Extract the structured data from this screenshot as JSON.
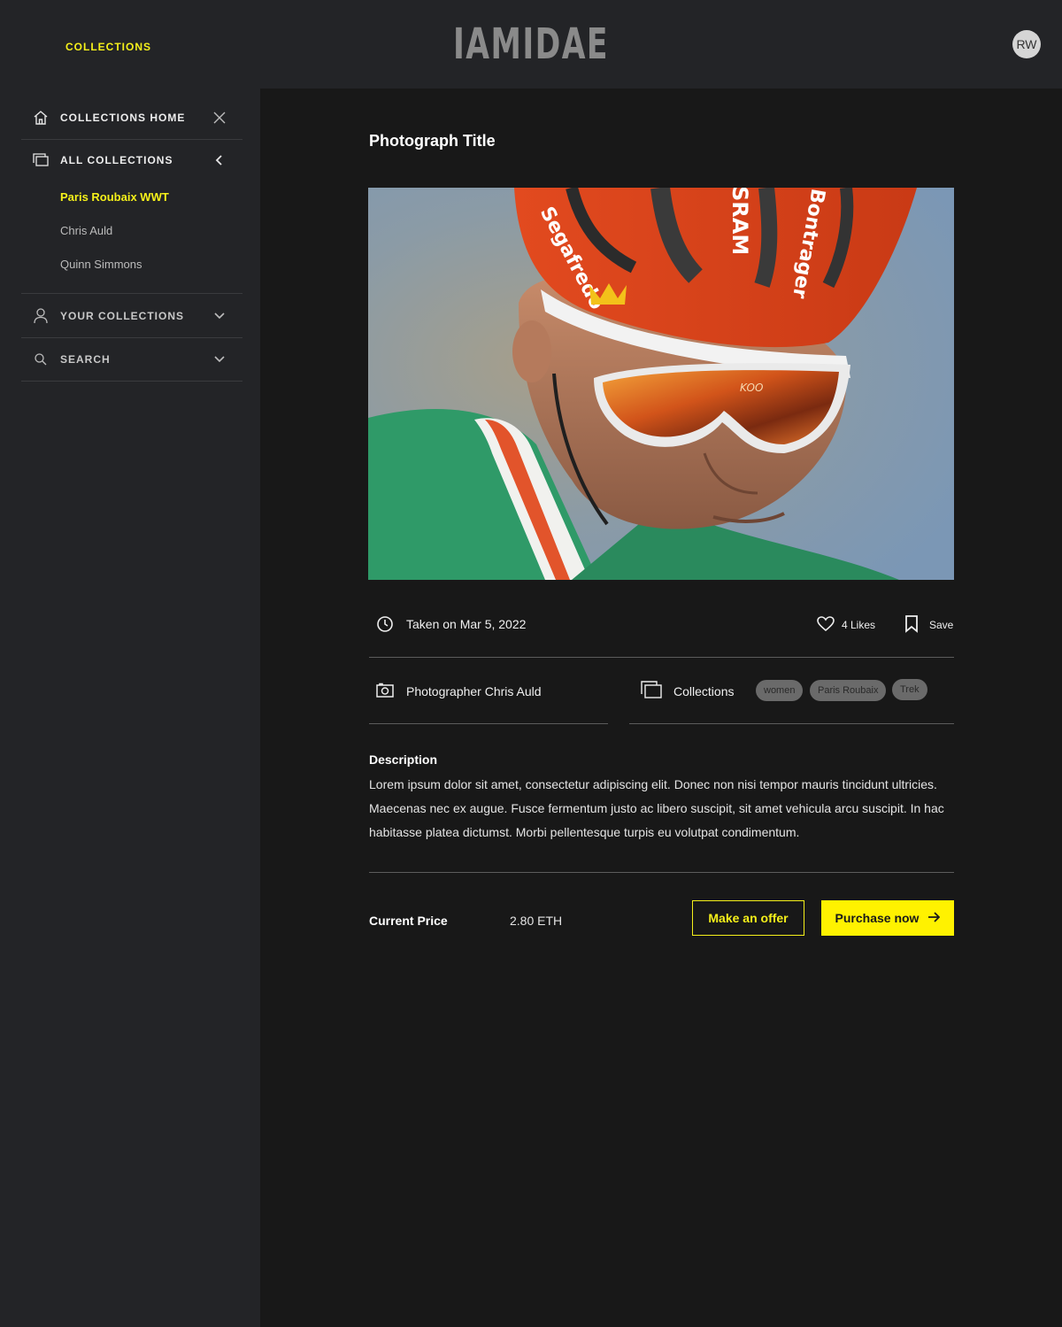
{
  "header": {
    "collections_link": "COLLECTIONS",
    "logo": "IAMIDAE",
    "avatar_initials": "RW"
  },
  "sidebar": {
    "home": {
      "label": "COLLECTIONS HOME",
      "icon": "home-icon",
      "action_icon": "close-icon"
    },
    "all_collections": {
      "label": "ALL COLLECTIONS",
      "icon": "collections-icon",
      "action_icon": "chevron-left-icon",
      "items": [
        {
          "label": "Paris Roubaix WWT",
          "active": true
        },
        {
          "label": "Chris Auld",
          "active": false
        },
        {
          "label": "Quinn Simmons",
          "active": false
        }
      ]
    },
    "your_collections": {
      "label": "YOUR COLLECTIONS",
      "icon": "user-icon",
      "action_icon": "chevron-down-icon"
    },
    "search": {
      "label": "SEARCH",
      "icon": "search-icon",
      "action_icon": "chevron-down-icon"
    }
  },
  "photo": {
    "title": "Photograph Title",
    "helmet_text_left": "Segafredo",
    "helmet_text_mid": "SRAM",
    "helmet_text_right": "Bontrager",
    "glasses_brand": "KOO"
  },
  "meta": {
    "taken_on": "Taken on Mar 5, 2022",
    "likes": "4 Likes",
    "save": "Save",
    "photographer": "Photographer Chris Auld",
    "collections_label": "Collections",
    "tags": [
      "women",
      "Paris Roubaix",
      "Trek"
    ]
  },
  "description": {
    "title": "Description",
    "body": "Lorem ipsum dolor sit amet, consectetur adipiscing elit. Donec non nisi tempor mauris tincidunt ultricies. Maecenas nec ex augue. Fusce fermentum justo ac libero suscipit, sit amet vehicula arcu suscipit. In hac habitasse platea dictumst. Morbi pellentesque turpis eu volutpat condimentum."
  },
  "purchase": {
    "price_label": "Current Price",
    "price_value": "2.80 ETH",
    "offer_button": "Make an offer",
    "buy_button": "Purchase now"
  },
  "colors": {
    "accent": "#f5f01a",
    "sidebar_bg": "#232427",
    "main_bg": "#181818"
  }
}
